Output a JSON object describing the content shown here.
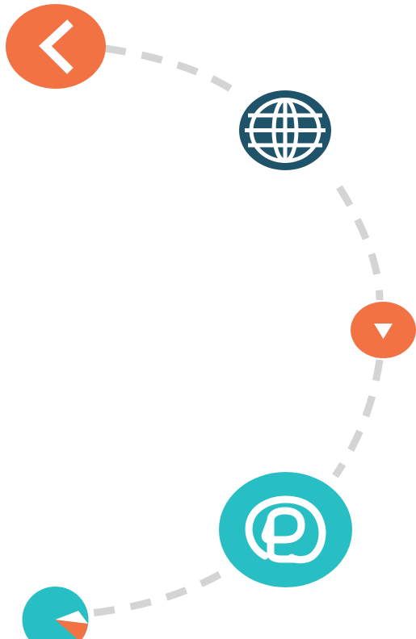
{
  "colors": {
    "orange": "#F27244",
    "navy": "#1F5369",
    "teal": "#27BFC3",
    "path_dash": "#D4D4D4",
    "background": "#FFFFFF"
  },
  "nodes": [
    {
      "id": "back",
      "icon": "chevron-left-icon",
      "shape": "ellipse",
      "color": "orange"
    },
    {
      "id": "globe",
      "icon": "globe-icon",
      "shape": "ellipse",
      "color": "navy"
    },
    {
      "id": "down",
      "icon": "triangle-down-icon",
      "shape": "ellipse",
      "color": "orange"
    },
    {
      "id": "at",
      "icon": "at-sign-icon",
      "shape": "ellipse",
      "color": "teal"
    },
    {
      "id": "pie",
      "icon": "pie-chart-icon",
      "shape": "circle",
      "color": "teal"
    }
  ]
}
